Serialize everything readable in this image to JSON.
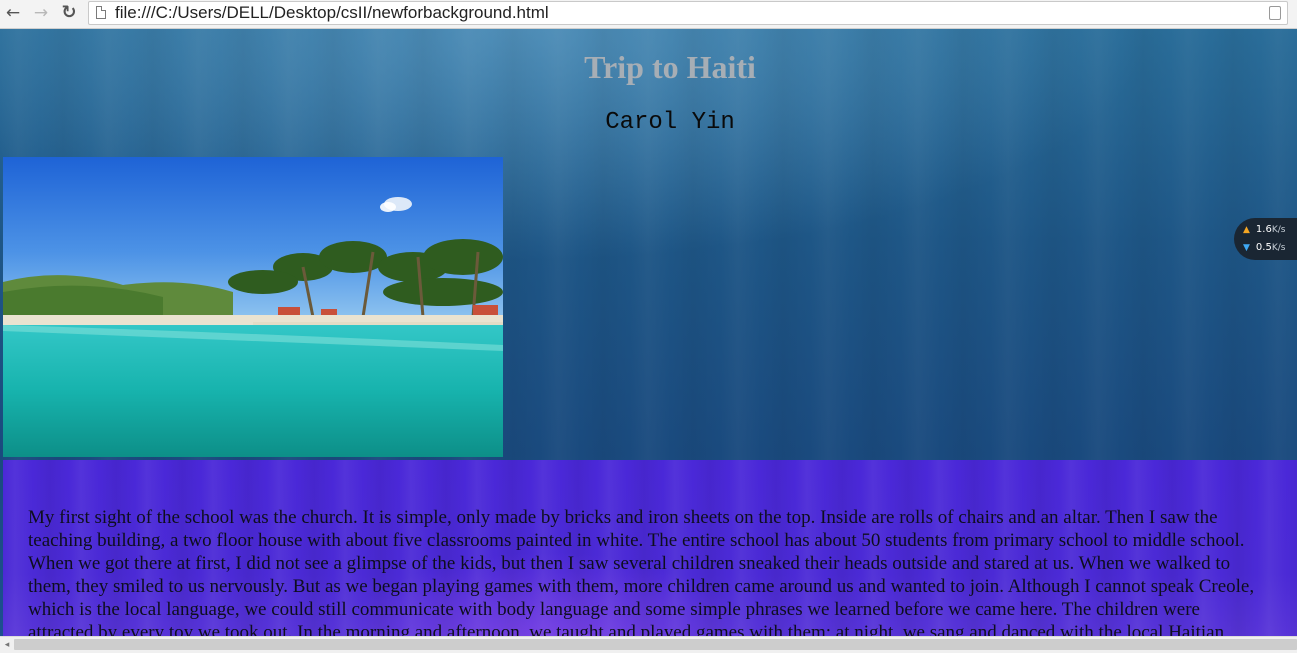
{
  "browser": {
    "back_glyph": "←",
    "forward_glyph": "→",
    "reload_glyph": "↻",
    "url": "file:///C:/Users/DELL/Desktop/csII/newforbackground.html",
    "icons": [
      "back-arrow-icon",
      "forward-arrow-icon",
      "reload-icon",
      "page-icon",
      "zoom-icon"
    ]
  },
  "page": {
    "title": "Trip to Haiti",
    "author": "Carol Yin",
    "image_description_icon": "beach-photo",
    "paragraph_lines": [
      "My first sight of the school was the church. It is simple, only made by bricks and iron sheets on the top. Inside are rolls of chairs and an altar. Then I saw the",
      "teaching building, a two floor house with about five classrooms painted in white. The entire school has about 50 students from primary school to middle school.",
      "When we got there at first, I did not see a glimpse of the kids, but then I saw several children sneaked their heads outside and stared at us. When we walked to",
      "them, they smiled to us nervously. But as we began playing games with them, more children came around us and wanted to join. Although I cannot speak Creole,",
      "which is the local language, we could still communicate with body language and some simple phrases we learned before we came here. The children were",
      "attracted by every toy we took out. In the morning and afternoon, we taught and played games with them; at night, we sang and danced with the local Haitian"
    ],
    "colors": {
      "title": "#a7aeb5",
      "author": "#0a0a0a",
      "content_bg": "#4a28d8",
      "page_bg": "#1e5686"
    }
  },
  "speed_widget": {
    "upload_value": "1.6",
    "download_value": "0.5",
    "unit": "K/s"
  },
  "scrollbar": {
    "left_glyph": "◂"
  }
}
